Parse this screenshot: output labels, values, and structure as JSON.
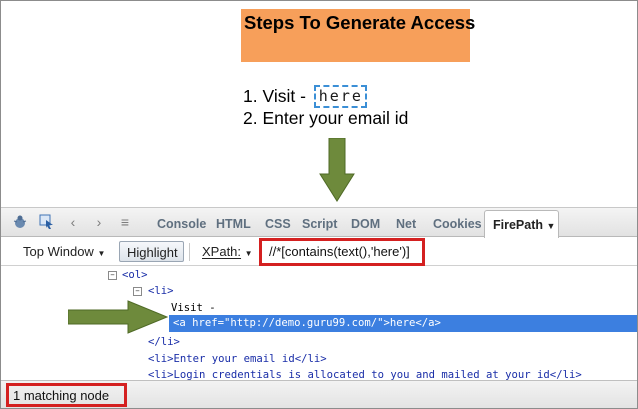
{
  "page": {
    "heading": "Steps To Generate Access",
    "steps": [
      {
        "prefix": "1. Visit - ",
        "link": "here"
      },
      {
        "text": "2. Enter your email id"
      }
    ]
  },
  "firebug": {
    "tabs": [
      "Console",
      "HTML",
      "CSS",
      "Script",
      "DOM",
      "Net",
      "Cookies"
    ],
    "active_tab": "FirePath",
    "toolbar": {
      "top_window": "Top Window",
      "highlight": "Highlight",
      "xpath_label": "XPath:",
      "xpath_value": "//*[contains(text(),'here')]"
    },
    "tree": {
      "ol_open": "<ol>",
      "li_open": "<li>",
      "visit_text": "Visit -",
      "selected": "<a href=\"http://demo.guru99.com/\">here</a>",
      "li_close": "</li>",
      "li2": "<li>Enter your email id</li>",
      "li3": "<li>Login credentials is allocated to you and mailed at your id</li>"
    },
    "status": "1 matching node"
  },
  "colors": {
    "heading_bg": "#f79f5a",
    "arrow": "#6e8a3c",
    "highlight_red": "#d42020",
    "selection": "#3c7fe0"
  }
}
